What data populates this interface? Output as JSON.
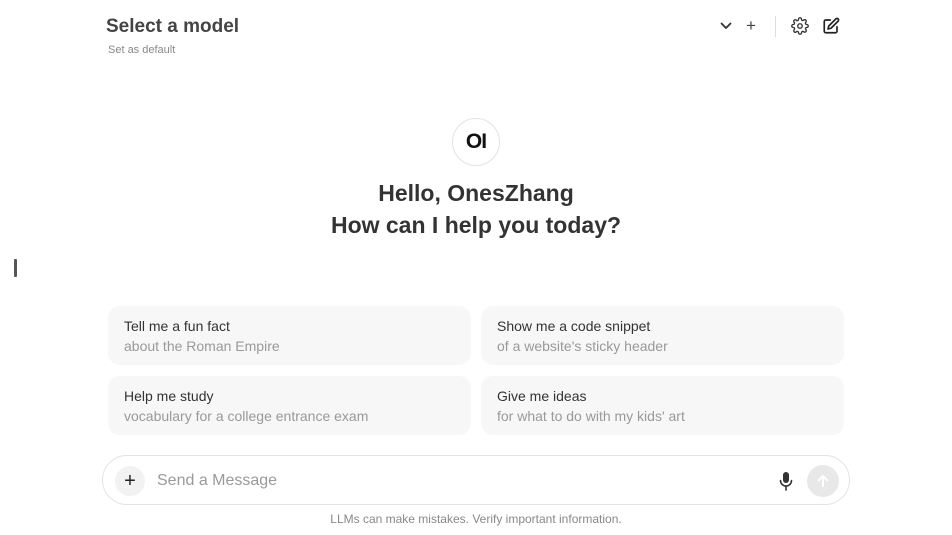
{
  "header": {
    "model_title": "Select a model",
    "set_default": "Set as default",
    "add_symbol": "+",
    "icons": [
      "chevron-down-icon",
      "plus-icon",
      "gear-icon",
      "edit-icon"
    ]
  },
  "logo": {
    "text": "OI"
  },
  "greeting": {
    "line1": "Hello, OnesZhang",
    "line2": "How can I help you today?"
  },
  "suggestions": [
    {
      "title": "Tell me a fun fact",
      "subtitle": "about the Roman Empire"
    },
    {
      "title": "Show me a code snippet",
      "subtitle": "of a website's sticky header"
    },
    {
      "title": "Help me study",
      "subtitle": "vocabulary for a college entrance exam"
    },
    {
      "title": "Give me ideas",
      "subtitle": "for what to do with my kids' art"
    }
  ],
  "composer": {
    "add_symbol": "+",
    "placeholder": "Send a Message",
    "value": "",
    "icons": [
      "plus-icon",
      "microphone-icon",
      "arrow-up-icon"
    ]
  },
  "footer": {
    "disclaimer": "LLMs can make mistakes. Verify important information."
  },
  "colors": {
    "card_bg": "#f7f7f7",
    "send_button_bg": "#e8e8e8",
    "text": "#333333"
  }
}
